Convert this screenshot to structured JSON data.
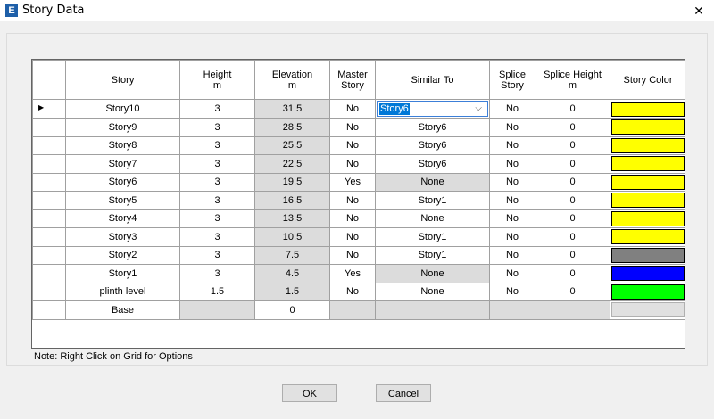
{
  "window": {
    "title": "Story Data",
    "app_icon_letter": "E",
    "close_glyph": "✕"
  },
  "grid": {
    "columns": [
      {
        "label": "",
        "unit": ""
      },
      {
        "label": "Story",
        "unit": ""
      },
      {
        "label": "Height",
        "unit": "m"
      },
      {
        "label": "Elevation",
        "unit": "m"
      },
      {
        "label": "Master",
        "unit": "Story"
      },
      {
        "label": "Similar To",
        "unit": ""
      },
      {
        "label": "Splice",
        "unit": "Story"
      },
      {
        "label": "Splice Height",
        "unit": "m"
      },
      {
        "label": "Story Color",
        "unit": ""
      }
    ],
    "active_row_indicator": "▶",
    "dropdown_arrow": "⌵",
    "rows": [
      {
        "story": "Story10",
        "height": "3",
        "elevation": "31.5",
        "master": "No",
        "similar": "Story6",
        "splice": "No",
        "splice_height": "0",
        "color": "#ffff00"
      },
      {
        "story": "Story9",
        "height": "3",
        "elevation": "28.5",
        "master": "No",
        "similar": "Story6",
        "splice": "No",
        "splice_height": "0",
        "color": "#ffff00"
      },
      {
        "story": "Story8",
        "height": "3",
        "elevation": "25.5",
        "master": "No",
        "similar": "Story6",
        "splice": "No",
        "splice_height": "0",
        "color": "#ffff00"
      },
      {
        "story": "Story7",
        "height": "3",
        "elevation": "22.5",
        "master": "No",
        "similar": "Story6",
        "splice": "No",
        "splice_height": "0",
        "color": "#ffff00"
      },
      {
        "story": "Story6",
        "height": "3",
        "elevation": "19.5",
        "master": "Yes",
        "similar": "None",
        "splice": "No",
        "splice_height": "0",
        "color": "#ffff00"
      },
      {
        "story": "Story5",
        "height": "3",
        "elevation": "16.5",
        "master": "No",
        "similar": "Story1",
        "splice": "No",
        "splice_height": "0",
        "color": "#ffff00"
      },
      {
        "story": "Story4",
        "height": "3",
        "elevation": "13.5",
        "master": "No",
        "similar": "None",
        "splice": "No",
        "splice_height": "0",
        "color": "#ffff00"
      },
      {
        "story": "Story3",
        "height": "3",
        "elevation": "10.5",
        "master": "No",
        "similar": "Story1",
        "splice": "No",
        "splice_height": "0",
        "color": "#ffff00"
      },
      {
        "story": "Story2",
        "height": "3",
        "elevation": "7.5",
        "master": "No",
        "similar": "Story1",
        "splice": "No",
        "splice_height": "0",
        "color": "#808080"
      },
      {
        "story": "Story1",
        "height": "3",
        "elevation": "4.5",
        "master": "Yes",
        "similar": "None",
        "splice": "No",
        "splice_height": "0",
        "color": "#0000ff"
      },
      {
        "story": "plinth level",
        "height": "1.5",
        "elevation": "1.5",
        "master": "No",
        "similar": "None",
        "splice": "No",
        "splice_height": "0",
        "color": "#00ff00"
      },
      {
        "story": "Base",
        "height": "",
        "elevation": "0",
        "master": "",
        "similar": "",
        "splice": "",
        "splice_height": "",
        "color": "#e0e0e0"
      }
    ]
  },
  "note": "Note:  Right Click on Grid for Options",
  "buttons": {
    "ok": "OK",
    "cancel": "Cancel"
  }
}
